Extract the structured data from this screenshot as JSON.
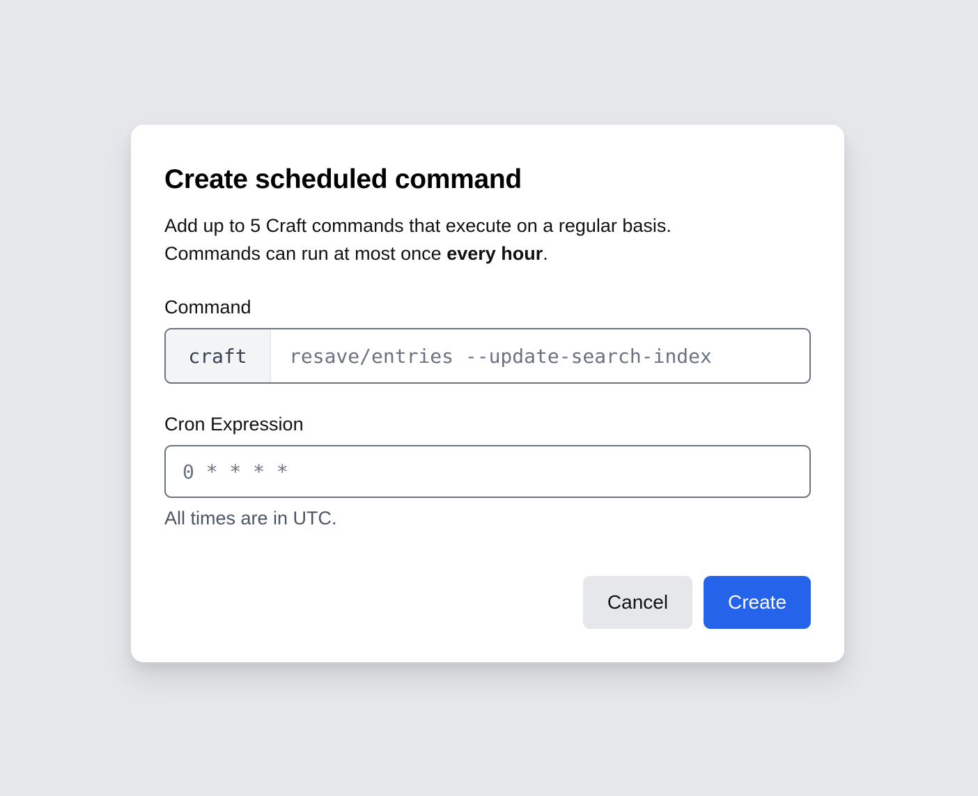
{
  "dialog": {
    "title": "Create scheduled command",
    "description_line1": "Add up to 5 Craft commands that execute on a regular basis.",
    "description_line2_prefix": "Commands can run at most once ",
    "description_line2_bold": "every hour",
    "description_line2_suffix": "."
  },
  "command": {
    "label": "Command",
    "prefix": "craft",
    "placeholder": "resave/entries --update-search-index",
    "value": ""
  },
  "cron": {
    "label": "Cron Expression",
    "placeholder": "0 * * * *",
    "value": "",
    "hint": "All times are in UTC."
  },
  "actions": {
    "cancel_label": "Cancel",
    "create_label": "Create"
  },
  "colors": {
    "background": "#e5e7eb",
    "primary": "#2563eb",
    "input_border": "#6b7280"
  }
}
